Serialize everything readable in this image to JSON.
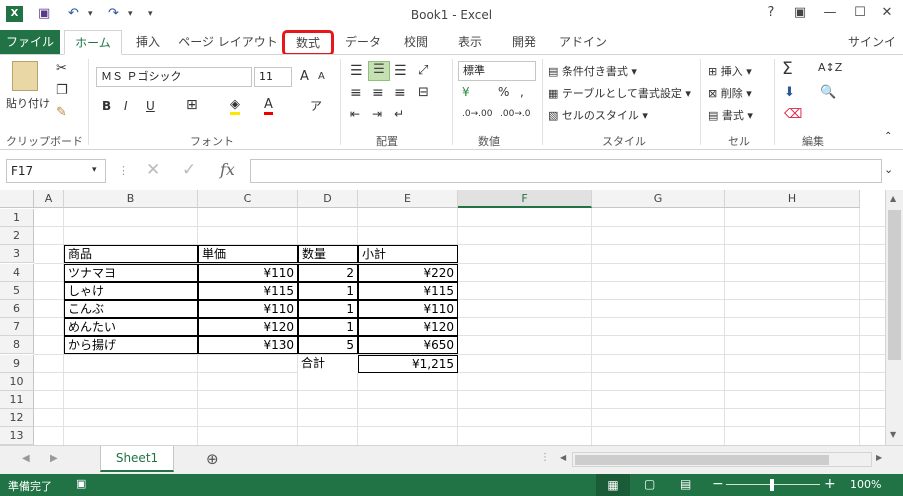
{
  "window": {
    "title": "Book1 - Excel",
    "help": "?",
    "controls": [
      "▣",
      "—",
      "☐",
      "✕"
    ]
  },
  "ribbon_tabs": {
    "file": "ファイル",
    "home": "ホーム",
    "insert": "挿入",
    "page_layout": "ページ レイアウト",
    "formulas": "数式",
    "data": "データ",
    "review": "校閲",
    "view": "表示",
    "developer": "開発",
    "addins": "アドイン",
    "signin": "サインイン"
  },
  "ribbon": {
    "clipboard": {
      "paste": "貼り付け",
      "group": "クリップボード"
    },
    "font": {
      "name": "ＭＳ Ｐゴシック",
      "size": "11",
      "group": "フォント",
      "bold": "B",
      "italic": "I",
      "underline": "U",
      "grow": "A",
      "shrink": "A"
    },
    "alignment": {
      "group": "配置"
    },
    "number": {
      "format": "標準",
      "group": "数値",
      "percent": "%",
      "comma": ","
    },
    "styles": {
      "conditional": "条件付き書式",
      "table": "テーブルとして書式設定",
      "cell_styles": "セルのスタイル",
      "group": "スタイル"
    },
    "cells": {
      "insert": "挿入",
      "delete": "削除",
      "format": "書式",
      "group": "セル"
    },
    "editing": {
      "group": "編集"
    }
  },
  "formula_bar": {
    "name_box": "F17",
    "formula": "",
    "fx": "fx"
  },
  "columns": [
    "A",
    "B",
    "C",
    "D",
    "E",
    "F",
    "G",
    "H"
  ],
  "rows": [
    "1",
    "2",
    "3",
    "4",
    "5",
    "6",
    "7",
    "8",
    "9",
    "10",
    "11",
    "12",
    "13"
  ],
  "table": {
    "headers": [
      "商品",
      "単価",
      "数量",
      "小計"
    ],
    "rows": [
      [
        "ツナマヨ",
        "¥110",
        "2",
        "¥220"
      ],
      [
        "しゃけ",
        "¥115",
        "1",
        "¥115"
      ],
      [
        "こんぶ",
        "¥110",
        "1",
        "¥110"
      ],
      [
        "めんたい",
        "¥120",
        "1",
        "¥120"
      ],
      [
        "から揚げ",
        "¥130",
        "5",
        "¥650"
      ]
    ],
    "total_label": "合計",
    "total_value": "¥1,215"
  },
  "sheets": {
    "active": "Sheet1",
    "add": "⊕"
  },
  "status": {
    "ready": "準備完了",
    "zoom": "100%"
  },
  "colors": {
    "excel_green": "#217346",
    "highlight_red": "#e8171b"
  }
}
